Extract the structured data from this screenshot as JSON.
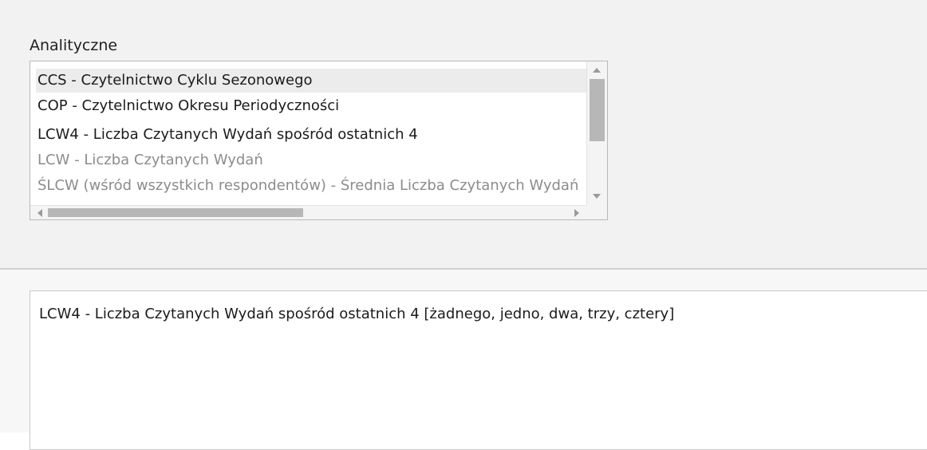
{
  "section_label": "Analityczne",
  "list": {
    "items": [
      {
        "label": "CCS - Czytelnictwo Cyklu Sezonowego",
        "state": "selected"
      },
      {
        "label": "COP - Czytelnictwo Okresu Periodyczności",
        "state": "enabled"
      },
      {
        "label": "LCW4 - Liczba Czytanych Wydań spośród ostatnich 4",
        "state": "enabled"
      },
      {
        "label": "LCW - Liczba Czytanych Wydań",
        "state": "disabled"
      },
      {
        "label": "ŚLCW (wśród wszystkich respondentów) - Średnia Liczba Czytanych Wydań",
        "state": "disabled"
      }
    ],
    "vertical_scroll_position": 0.0,
    "horizontal_scroll_position": 0.0
  },
  "detail": {
    "text": "LCW4 - Liczba Czytanych Wydań spośród ostatnich 4 [żadnego, jedno, dwa, trzy, cztery]"
  },
  "icons": {
    "scroll_up": "triangle-up-icon",
    "scroll_down": "triangle-down-icon",
    "scroll_left": "triangle-left-icon",
    "scroll_right": "triangle-right-icon"
  },
  "colors": {
    "enabled_text": "#1b1b1b",
    "disabled_text": "#8c8c8c",
    "selection": "#ececec",
    "panel_background": "#f2f2f2"
  }
}
